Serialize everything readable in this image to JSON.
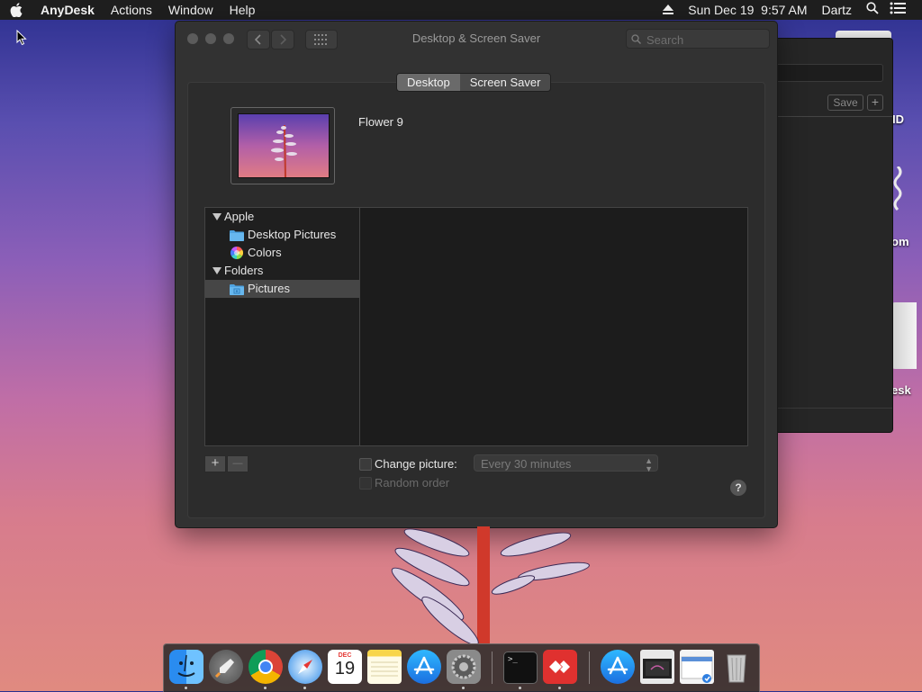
{
  "menubar": {
    "app_name": "AnyDesk",
    "menus": [
      "Actions",
      "Window",
      "Help"
    ],
    "clock": "Sun Dec 19  9:57 AM",
    "user": "Dartz"
  },
  "background_window": {
    "save_label": "Save",
    "plus_label": "+"
  },
  "desktop_labels": [
    "ID",
    "om",
    "esk"
  ],
  "window": {
    "title": "Desktop & Screen Saver",
    "search_placeholder": "Search",
    "tabs": [
      {
        "label": "Desktop",
        "selected": true
      },
      {
        "label": "Screen Saver",
        "selected": false
      }
    ],
    "current_picture": "Flower 9",
    "sources": [
      {
        "label": "Apple",
        "type": "group"
      },
      {
        "label": "Desktop Pictures",
        "type": "folder-icon"
      },
      {
        "label": "Colors",
        "type": "color-wheel-icon"
      },
      {
        "label": "Folders",
        "type": "group"
      },
      {
        "label": "Pictures",
        "type": "pictures-folder-icon",
        "selected": true
      }
    ],
    "add_label": "+",
    "remove_label": "—",
    "change_picture_label": "Change picture:",
    "interval_value": "Every 30 minutes",
    "random_order_label": "Random order",
    "help_label": "?"
  },
  "dock": {
    "calendar_month": "DEC",
    "calendar_day": "19",
    "items": [
      "finder-icon",
      "launchpad-icon",
      "chrome-icon",
      "safari-icon",
      "calendar-icon",
      "notes-icon",
      "app-store-icon",
      "system-preferences-icon",
      "terminal-icon",
      "anydesk-icon",
      "app-store-download-icon",
      "preview-icon",
      "screenshot-icon",
      "trash-icon"
    ]
  },
  "colors": {
    "menubar": "#1e1e1e",
    "window_bg": "#323232",
    "selection": "#464646",
    "anydesk_red": "#e0312f"
  }
}
